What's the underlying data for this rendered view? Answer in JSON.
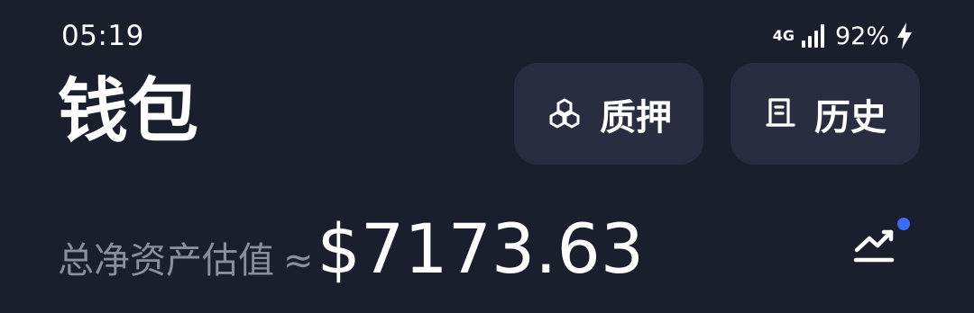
{
  "status_bar": {
    "time": "05:19",
    "network": "4G",
    "battery": "92%"
  },
  "header": {
    "title": "钱包",
    "stake_label": "质押",
    "history_label": "历史"
  },
  "assets": {
    "label": "总净资产估值",
    "approx": "≈",
    "value": "$7173.63"
  },
  "colors": {
    "background": "#1a1f2e",
    "button_bg": "#282e3f",
    "muted_text": "#8a8f9e",
    "dot": "#3b6df5"
  },
  "icons": [
    "stake-icon",
    "history-icon",
    "trend-chart-icon",
    "signal-icon",
    "charging-bolt-icon"
  ]
}
